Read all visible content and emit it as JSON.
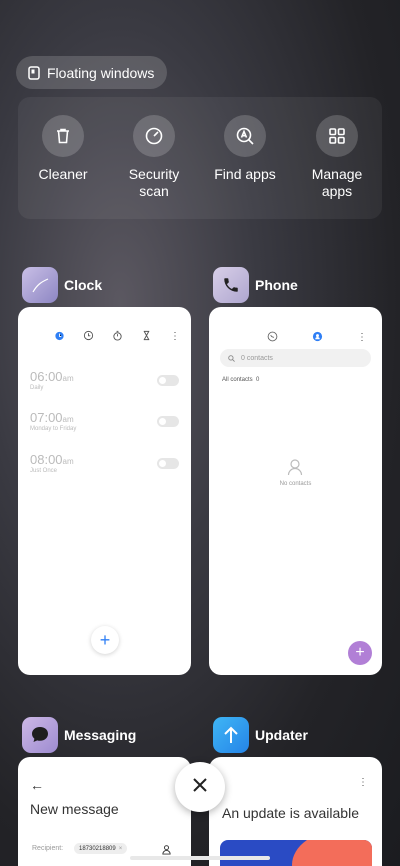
{
  "floating": {
    "label": "Floating windows"
  },
  "tools": [
    {
      "label": "Cleaner",
      "icon": "trash-icon"
    },
    {
      "label": "Security\nscan",
      "icon": "security-scan-icon"
    },
    {
      "label": "Find apps",
      "icon": "find-apps-icon"
    },
    {
      "label": "Manage\napps",
      "icon": "manage-apps-icon"
    }
  ],
  "apps": {
    "clock": {
      "name": "Clock",
      "alarms": [
        {
          "time": "06:00",
          "ampm": "am",
          "repeat": "Daily"
        },
        {
          "time": "07:00",
          "ampm": "am",
          "repeat": "Monday to Friday"
        },
        {
          "time": "08:00",
          "ampm": "am",
          "repeat": "Just Once"
        }
      ]
    },
    "phone": {
      "name": "Phone",
      "search_placeholder": "0 contacts",
      "all_contacts": "All contacts",
      "count": "0",
      "empty": "No contacts"
    },
    "messaging": {
      "name": "Messaging",
      "title": "New message",
      "recipient_label": "Recipient:",
      "recipient_value": "18730218809"
    },
    "updater": {
      "name": "Updater",
      "title": "An update is available"
    }
  },
  "colors": {
    "accent": "#2f7ff5",
    "phone_fab": "#b17fd6"
  }
}
